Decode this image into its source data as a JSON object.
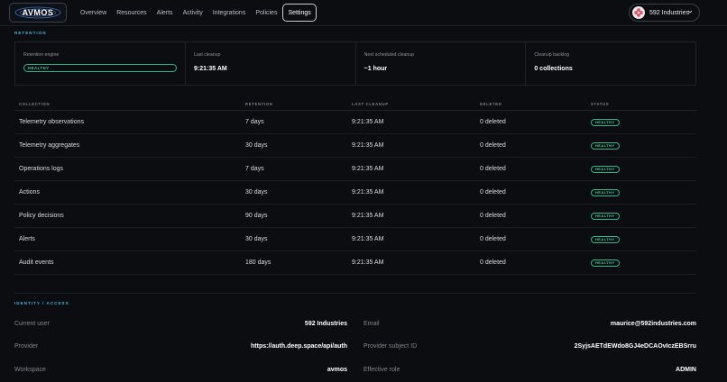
{
  "nav": {
    "logo_text": "AVMOS",
    "items": [
      {
        "label": "Overview"
      },
      {
        "label": "Resources"
      },
      {
        "label": "Alerts"
      },
      {
        "label": "Activity"
      },
      {
        "label": "Integrations"
      },
      {
        "label": "Policies"
      },
      {
        "label": "Settings",
        "active": true
      }
    ],
    "org_name": "592 Industries"
  },
  "retention": {
    "section_label": "RETENTION",
    "cards": [
      {
        "title": "Retention engine",
        "badge": "HEALTHY"
      },
      {
        "title": "Last cleanup",
        "value": "9:21:35 AM"
      },
      {
        "title": "Next scheduled cleanup",
        "value": "~1 hour"
      },
      {
        "title": "Cleanup backlog",
        "value": "0 collections"
      }
    ],
    "table": {
      "headers": [
        "COLLECTION",
        "RETENTION",
        "LAST CLEANUP",
        "DELETED",
        "STATUS"
      ],
      "rows": [
        {
          "collection": "Telemetry observations",
          "retention": "7 days",
          "last_cleanup": "9:21:35 AM",
          "deleted": "0 deleted",
          "status": "HEALTHY"
        },
        {
          "collection": "Telemetry aggregates",
          "retention": "30 days",
          "last_cleanup": "9:21:35 AM",
          "deleted": "0 deleted",
          "status": "HEALTHY"
        },
        {
          "collection": "Operations logs",
          "retention": "7 days",
          "last_cleanup": "9:21:35 AM",
          "deleted": "0 deleted",
          "status": "HEALTHY"
        },
        {
          "collection": "Actions",
          "retention": "30 days",
          "last_cleanup": "9:21:35 AM",
          "deleted": "0 deleted",
          "status": "HEALTHY"
        },
        {
          "collection": "Policy decisions",
          "retention": "90 days",
          "last_cleanup": "9:21:35 AM",
          "deleted": "0 deleted",
          "status": "HEALTHY"
        },
        {
          "collection": "Alerts",
          "retention": "30 days",
          "last_cleanup": "9:21:35 AM",
          "deleted": "0 deleted",
          "status": "HEALTHY"
        },
        {
          "collection": "Audit events",
          "retention": "180 days",
          "last_cleanup": "9:21:35 AM",
          "deleted": "0 deleted",
          "status": "HEALTHY"
        }
      ]
    }
  },
  "identity": {
    "section_label": "IDENTITY / ACCESS",
    "fields": [
      {
        "label": "Current user",
        "value": "592 Industries"
      },
      {
        "label": "Email",
        "value": "maurice@592industries.com"
      },
      {
        "label": "Provider",
        "value": "https://auth.deep.space/api/auth"
      },
      {
        "label": "Provider subject ID",
        "value": "2SyjsAETdEWdo8GJ4eDCAOvIczEBSrru"
      },
      {
        "label": "Workspace",
        "value": "avmos"
      },
      {
        "label": "Effective role",
        "value": "ADMIN"
      }
    ]
  },
  "colors": {
    "background": "#0b0d11",
    "accent_label": "#4fb0dc",
    "healthy": "#48d7a3"
  }
}
